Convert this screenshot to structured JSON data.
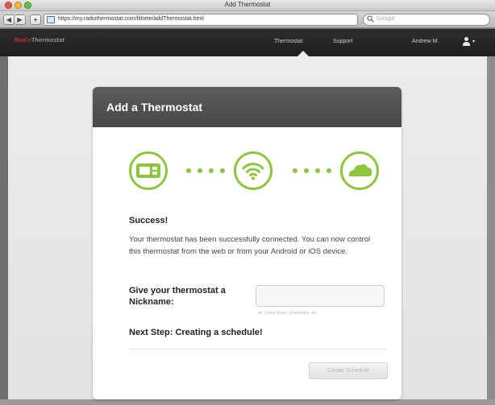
{
  "window": {
    "title": "Add Thermostat"
  },
  "browser": {
    "back_label": "◀",
    "forward_label": "▶",
    "new_tab_label": "+",
    "url": "https://my.radiothermostat.com/filtrete/addThermostat.html",
    "reload_glyph": "C",
    "search_placeholder": "Google"
  },
  "site_nav": {
    "logo_a": "Radio",
    "logo_b": "Thermostat",
    "links": [
      "Thermostat",
      "Support",
      "Andrew M."
    ],
    "user_caret": "▾"
  },
  "card": {
    "title": "Add a Thermostat",
    "steps": [
      "thermostat-device-icon",
      "wifi-icon",
      "cloud-icon"
    ],
    "success_heading": "Success!",
    "success_text": "Your thermostat has been successfully connected. You can now control this thermostat from the web or from your Android or iOS device.",
    "nickname_label": "Give your thermostat a Nickname:",
    "nickname_value": "",
    "nickname_hint": "ex: Living Room, Downstairs, etc.",
    "next_step": "Next Step: Creating a schedule!",
    "button_label": "Create Schedule"
  },
  "colors": {
    "accent_green": "#8cc63f",
    "header_dark": "#4f4f4f",
    "nav_dark": "#262626",
    "logo_red": "#c0302c"
  }
}
